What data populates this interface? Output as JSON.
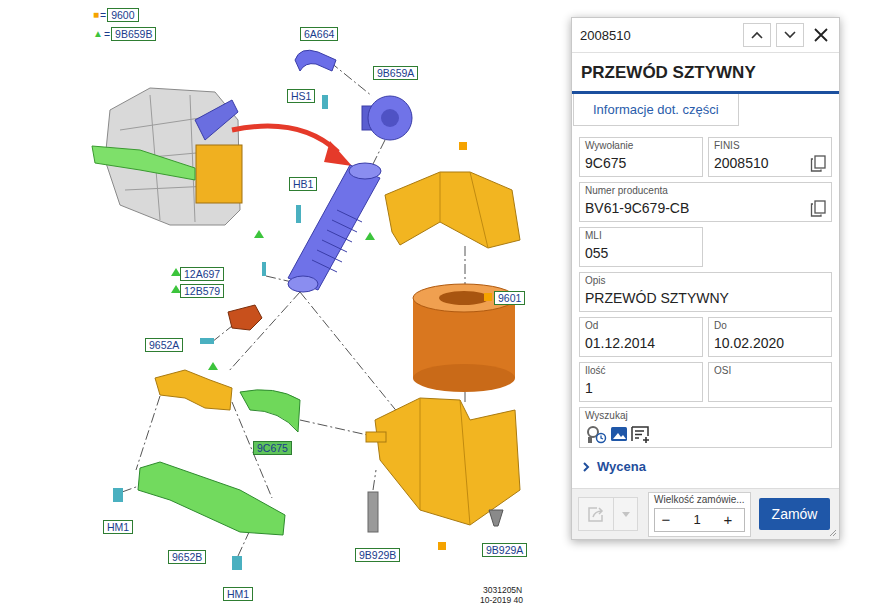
{
  "diagram": {
    "legend": [
      {
        "symbol": "■",
        "eq": "=",
        "code": "9600",
        "color": "#f5a300"
      },
      {
        "symbol": "▲",
        "eq": "=",
        "code": "9B659B",
        "color": "#3cc43c"
      }
    ],
    "callouts": [
      {
        "code": "6A664",
        "selected": false
      },
      {
        "code": "9B659A",
        "selected": false
      },
      {
        "code": "HS1",
        "selected": false
      },
      {
        "code": "HB1",
        "selected": false
      },
      {
        "code": "9601",
        "selected": false
      },
      {
        "code": "12A697",
        "selected": false
      },
      {
        "code": "12B579",
        "selected": false
      },
      {
        "code": "9652A",
        "selected": false
      },
      {
        "code": "9C675",
        "selected": true
      },
      {
        "code": "HM1",
        "selected": false
      },
      {
        "code": "9652B",
        "selected": false
      },
      {
        "code": "HM1",
        "selected": false
      },
      {
        "code": "9B929B",
        "selected": false
      },
      {
        "code": "9B929A",
        "selected": false
      }
    ],
    "drawing_number": "3031205N",
    "drawing_date": "10-2019 40"
  },
  "panel": {
    "header": {
      "title": "2008510"
    },
    "title": "PRZEWÓD SZTYWNY",
    "tabs": [
      {
        "label": "Informacje dot. części",
        "selected": true
      }
    ],
    "fields": [
      {
        "label": "Wywołanie",
        "value": "9C675",
        "kind": "plain"
      },
      {
        "label": "FINIS",
        "value": "2008510",
        "kind": "copyable"
      },
      {
        "label": "Numer producenta",
        "value": "BV61-9C679-CB",
        "kind": "copyable"
      },
      {
        "label": "MLI",
        "value": "055",
        "kind": "plain"
      },
      {
        "label": "Opis",
        "value": "PRZEWÓD SZTYWNY",
        "kind": "plain"
      },
      {
        "label": "Od",
        "value": "01.12.2014",
        "kind": "plain"
      },
      {
        "label": "Do",
        "value": "10.02.2020",
        "kind": "plain"
      },
      {
        "label": "Ilość",
        "value": "1",
        "kind": "plain"
      },
      {
        "label": "OSI",
        "value": "",
        "kind": "plain"
      }
    ],
    "search": {
      "label": "Wyszukaj"
    },
    "pricing": {
      "label": "Wycena",
      "expanded": false
    },
    "footer": {
      "share": {
        "disabled": true
      },
      "menu": {
        "disabled": true
      },
      "quantity": {
        "label": "Wielkość zamówie...",
        "minus": "−",
        "value": "1",
        "plus": "+"
      },
      "order": "Zamów"
    }
  }
}
